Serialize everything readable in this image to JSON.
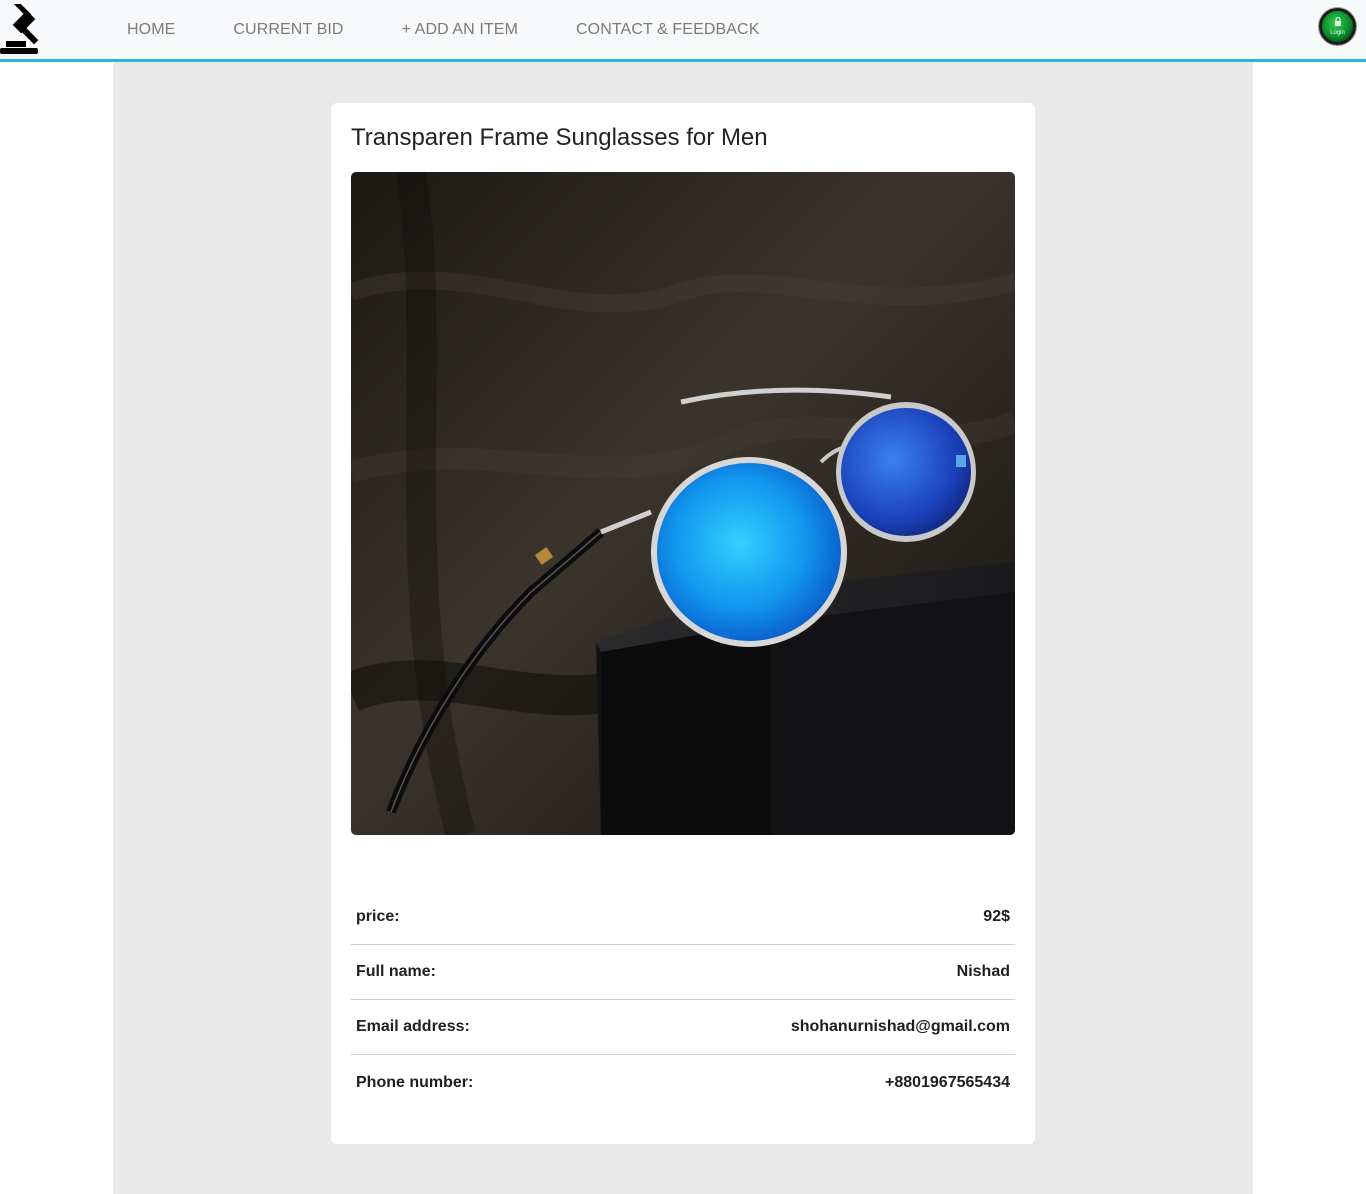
{
  "nav": {
    "links": [
      {
        "label": "HOME"
      },
      {
        "label": "CURRENT BID"
      },
      {
        "label": "+ ADD AN ITEM"
      },
      {
        "label": "CONTACT & FEEDBACK"
      }
    ],
    "login_label": "Login",
    "logo_icon": "gavel-icon"
  },
  "item": {
    "title": "Transparen Frame Sunglasses for Men",
    "image_alt": "Blue mirrored aviator sunglasses on black box",
    "details": [
      {
        "label": "price:",
        "value": "92$"
      },
      {
        "label": "Full name:",
        "value": "Nishad"
      },
      {
        "label": "Email address:",
        "value": "shohanurnishad@gmail.com"
      },
      {
        "label": "Phone number:",
        "value": "+8801967565434"
      }
    ]
  },
  "colors": {
    "accent": "#29b6d8",
    "page_bg": "#e9e9e9",
    "navbar_bg": "#f8f9fa"
  }
}
